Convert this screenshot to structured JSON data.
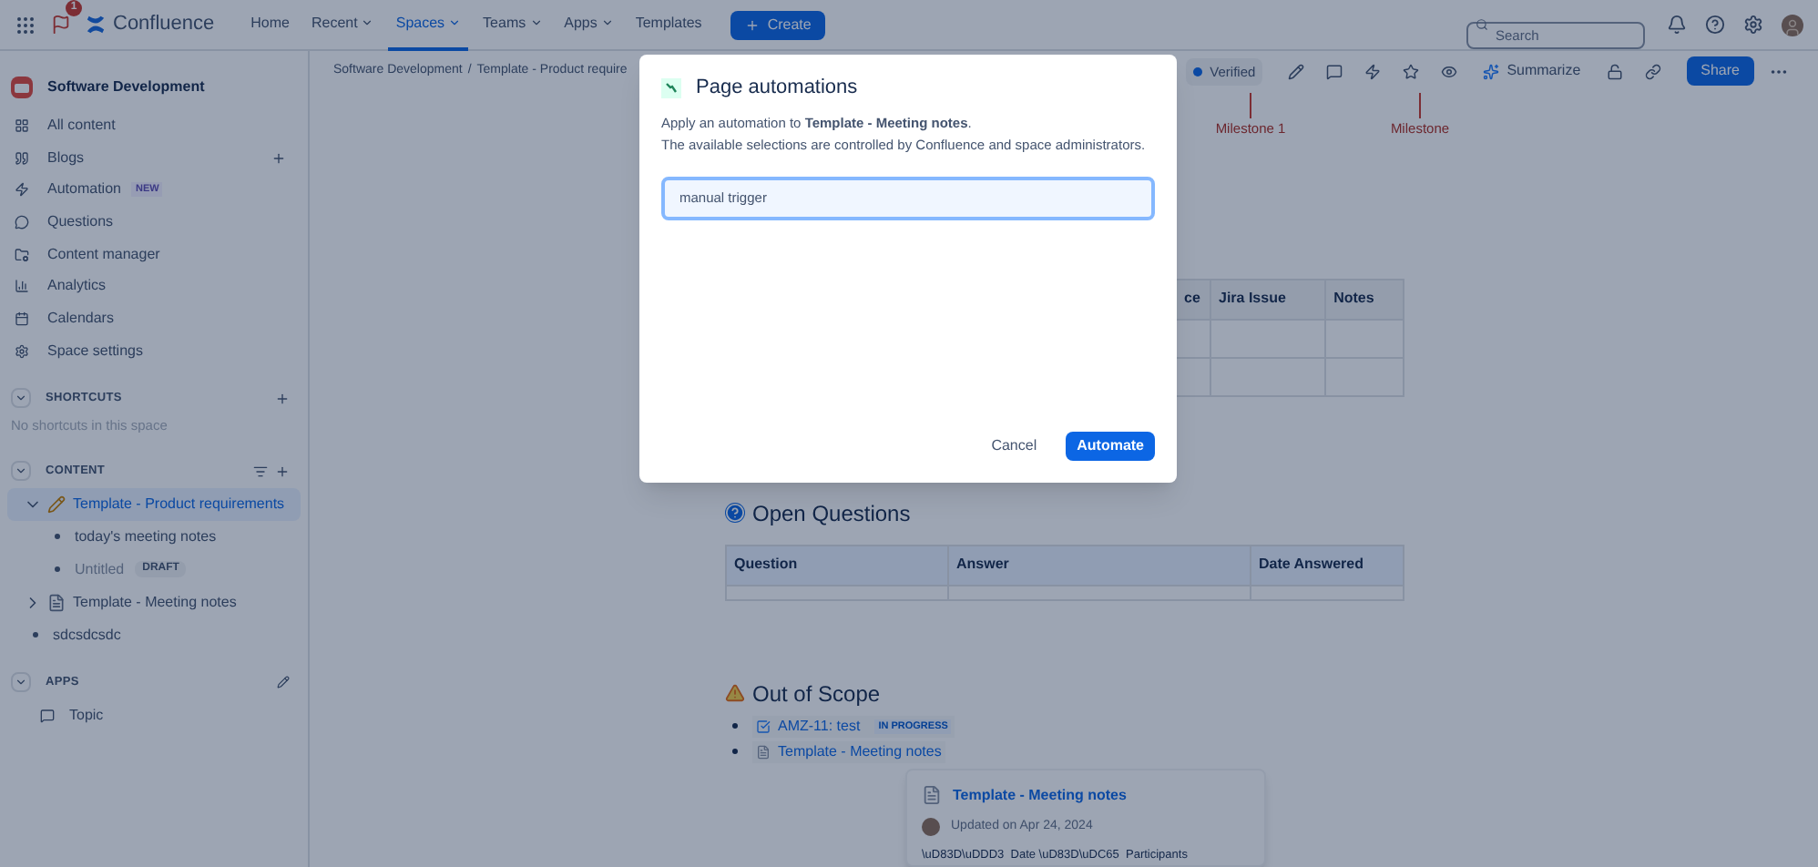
{
  "nav": {
    "notification_count": "1",
    "product": "Confluence",
    "items": [
      {
        "label": "Home",
        "dropdown": false,
        "selected": false
      },
      {
        "label": "Recent",
        "dropdown": true,
        "selected": false
      },
      {
        "label": "Spaces",
        "dropdown": true,
        "selected": true
      },
      {
        "label": "Teams",
        "dropdown": true,
        "selected": false
      },
      {
        "label": "Apps",
        "dropdown": true,
        "selected": false
      },
      {
        "label": "Templates",
        "dropdown": false,
        "selected": false
      }
    ],
    "create": "Create",
    "search": {
      "placeholder": "Search"
    }
  },
  "sidebar": {
    "space_name": "Software Development",
    "items": [
      {
        "label": "All content"
      },
      {
        "label": "Blogs",
        "add": true
      },
      {
        "label": "Automation",
        "badge": "NEW"
      },
      {
        "label": "Questions"
      },
      {
        "label": "Content manager"
      },
      {
        "label": "Analytics"
      },
      {
        "label": "Calendars"
      },
      {
        "label": "Space settings"
      }
    ],
    "shortcuts": {
      "title": "SHORTCUTS",
      "empty": "No shortcuts in this space"
    },
    "content": {
      "title": "CONTENT",
      "tree": [
        {
          "label": "Template - Product requirements",
          "kind": "pencil",
          "selected": true,
          "expanded": true,
          "children": [
            {
              "label": "today's meeting notes",
              "kind": "bullet",
              "selected": false,
              "draft": false
            },
            {
              "label": "Untitled",
              "kind": "bullet",
              "selected": false,
              "draft": true,
              "badge": "DRAFT"
            }
          ]
        },
        {
          "label": "Template - Meeting notes",
          "kind": "document",
          "selected": false,
          "expanded": false
        },
        {
          "label": "sdcsdcsdc",
          "kind": "bullet",
          "selected": false,
          "draft": false
        }
      ]
    },
    "apps": {
      "title": "APPS",
      "items": [
        {
          "label": "Topic"
        }
      ]
    }
  },
  "page": {
    "breadcrumb": {
      "separator": "/",
      "items": [
        "Software Development",
        "Template - Product require"
      ]
    },
    "toolbar": {
      "status": "Verified",
      "summarize": "Summarize",
      "share": "Share"
    },
    "milestones": [
      "Milestone 1",
      "Milestone"
    ],
    "table": {
      "columns": [
        "ce",
        "Jira Issue",
        "Notes"
      ]
    },
    "open_questions": {
      "title": "Open Questions",
      "columns": [
        "Question",
        "Answer",
        "Date Answered"
      ]
    },
    "out_of_scope": {
      "title": "Out of Scope",
      "items": [
        {
          "kind": "issue",
          "label": "AMZ-11: test",
          "status": "IN PROGRESS"
        },
        {
          "kind": "page",
          "label": "Template - Meeting notes"
        }
      ]
    },
    "hover_card": {
      "title": "Template - Meeting notes",
      "updated": "Updated on Apr 24, 2024",
      "excerpt": "\\uD83D\\uDDD3  Date \\uD83D\\uDC65  Participants"
    }
  },
  "modal": {
    "title": "Page automations",
    "description": "Apply an automation to **Template - Meeting notes**.",
    "note": "The available selections are controlled by Confluence and space administrators.",
    "input": {
      "value": "manual trigger"
    },
    "cancel": "Cancel",
    "confirm": "Automate"
  }
}
